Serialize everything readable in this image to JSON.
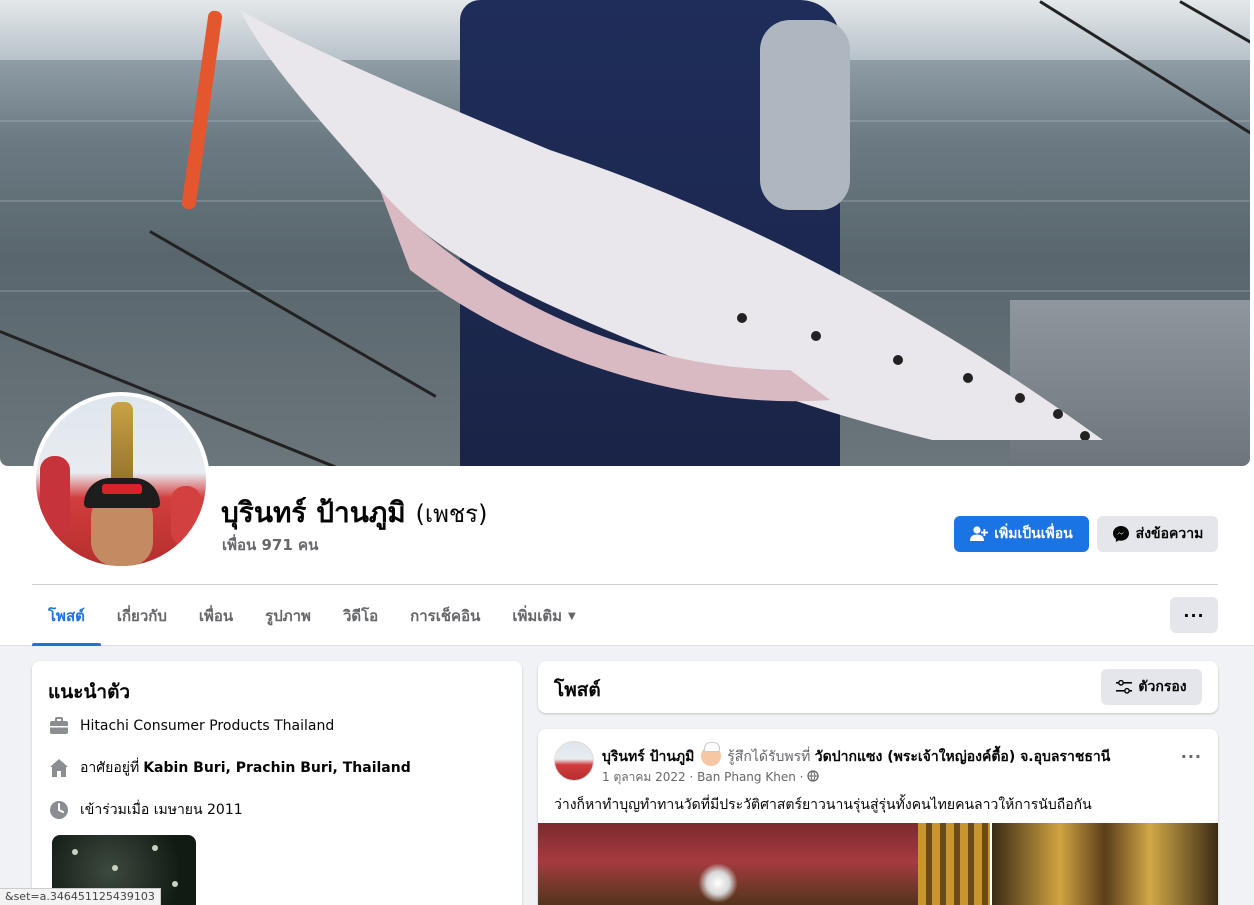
{
  "profile": {
    "name": "บุรินทร์ ป้านภูมิ",
    "nickname": "(เพชร)",
    "friends_label": "เพื่อน 971 คน"
  },
  "actions": {
    "add_friend": "เพิ่มเป็นเพื่อน",
    "message": "ส่งข้อความ"
  },
  "tabs": [
    {
      "label": "โพสต์",
      "active": true
    },
    {
      "label": "เกี่ยวกับ",
      "active": false
    },
    {
      "label": "เพื่อน",
      "active": false
    },
    {
      "label": "รูปภาพ",
      "active": false
    },
    {
      "label": "วิดีโอ",
      "active": false
    },
    {
      "label": "การเช็คอิน",
      "active": false
    },
    {
      "label": "เพิ่มเติม",
      "active": false
    }
  ],
  "more_button": "···",
  "intro": {
    "title": "แนะนำตัว",
    "work": "Hitachi Consumer Products Thailand",
    "lives_prefix": "อาศัยอยู่ที่",
    "lives_place": "Kabin Buri, Prachin Buri, Thailand",
    "joined": "เข้าร่วมเมื่อ เมษายน 2011"
  },
  "posts_header": {
    "title": "โพสต์",
    "filter_label": "ตัวกรอง"
  },
  "post": {
    "author": "บุรินทร์ ป้านภูมิ",
    "feeling": "รู้สึกได้รับพรที่",
    "place": "วัดปากแซง (พระเจ้าใหญ่องค์ตื้อ) จ.อุบลราชธานี",
    "date": "1 ตุลาคม 2022",
    "location": "Ban Phang Khen",
    "separator": "·",
    "text": "ว่างก็หาทำบุญทำทานวัดที่มีประวัติศาสตร์ยาวนานรุ่นสู่รุ่นทั้งคนไทยคนลาวให้การนับถือกัน",
    "more": "···"
  },
  "status_url": "&set=a.346451125439103",
  "colors": {
    "accent": "#1b74e4",
    "background": "#f0f2f5",
    "secondary_text": "#65676b"
  }
}
